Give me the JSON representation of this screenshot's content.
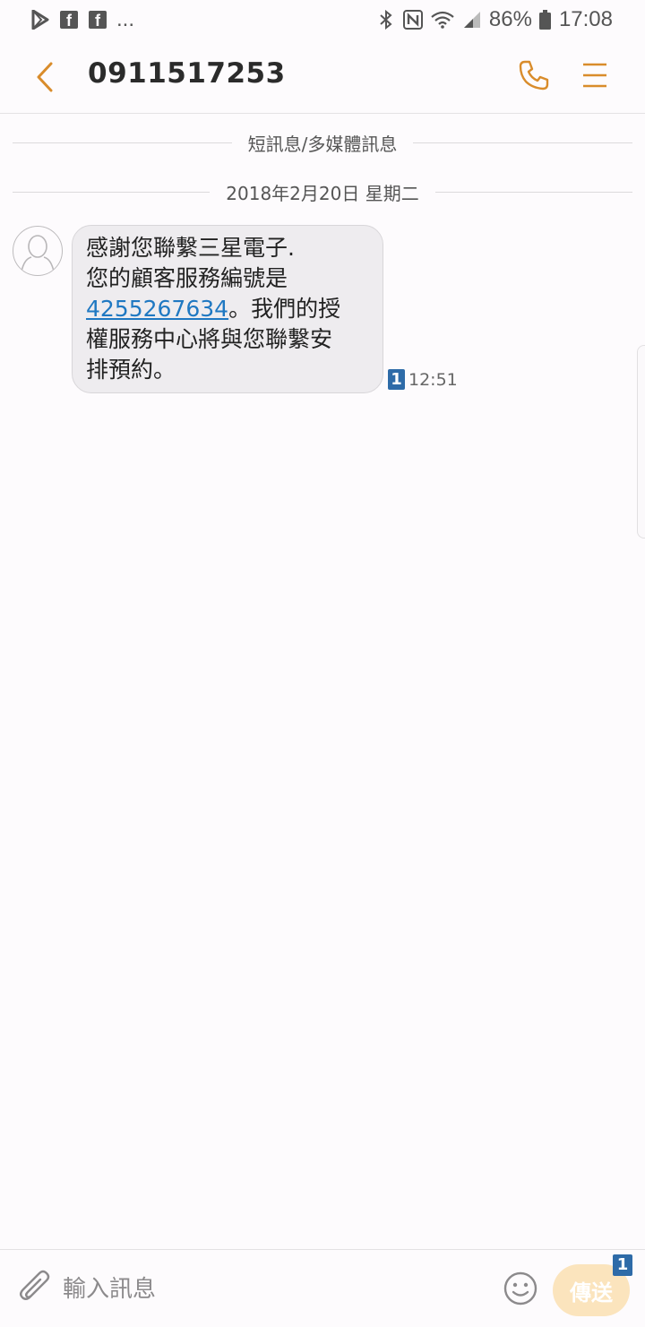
{
  "status_bar": {
    "overflow_text": "...",
    "battery_text": "86%",
    "time": "17:08",
    "left_icons": [
      "play-store-icon",
      "facebook-icon",
      "facebook-icon"
    ],
    "right_icons": [
      "bluetooth-icon",
      "nfc-icon",
      "wifi-icon",
      "signal-icon",
      "battery-icon"
    ]
  },
  "header": {
    "title": "0911517253",
    "accent_color": "#d98c2b"
  },
  "conversation": {
    "type_label": "短訊息/多媒體訊息",
    "date_label": "2018年2月20日 星期二",
    "messages": [
      {
        "line1": "感謝您聯繫三星電子.",
        "line2": "您的顧客服務編號是",
        "link": "4255267634",
        "line3_rest": "。我們的授",
        "line4": "權服務中心將與您聯繫安",
        "line5": "排預約。",
        "sim": "1",
        "time": "12:51"
      }
    ]
  },
  "composer": {
    "placeholder": "輸入訊息",
    "send_label": "傳送",
    "send_sim": "1"
  }
}
